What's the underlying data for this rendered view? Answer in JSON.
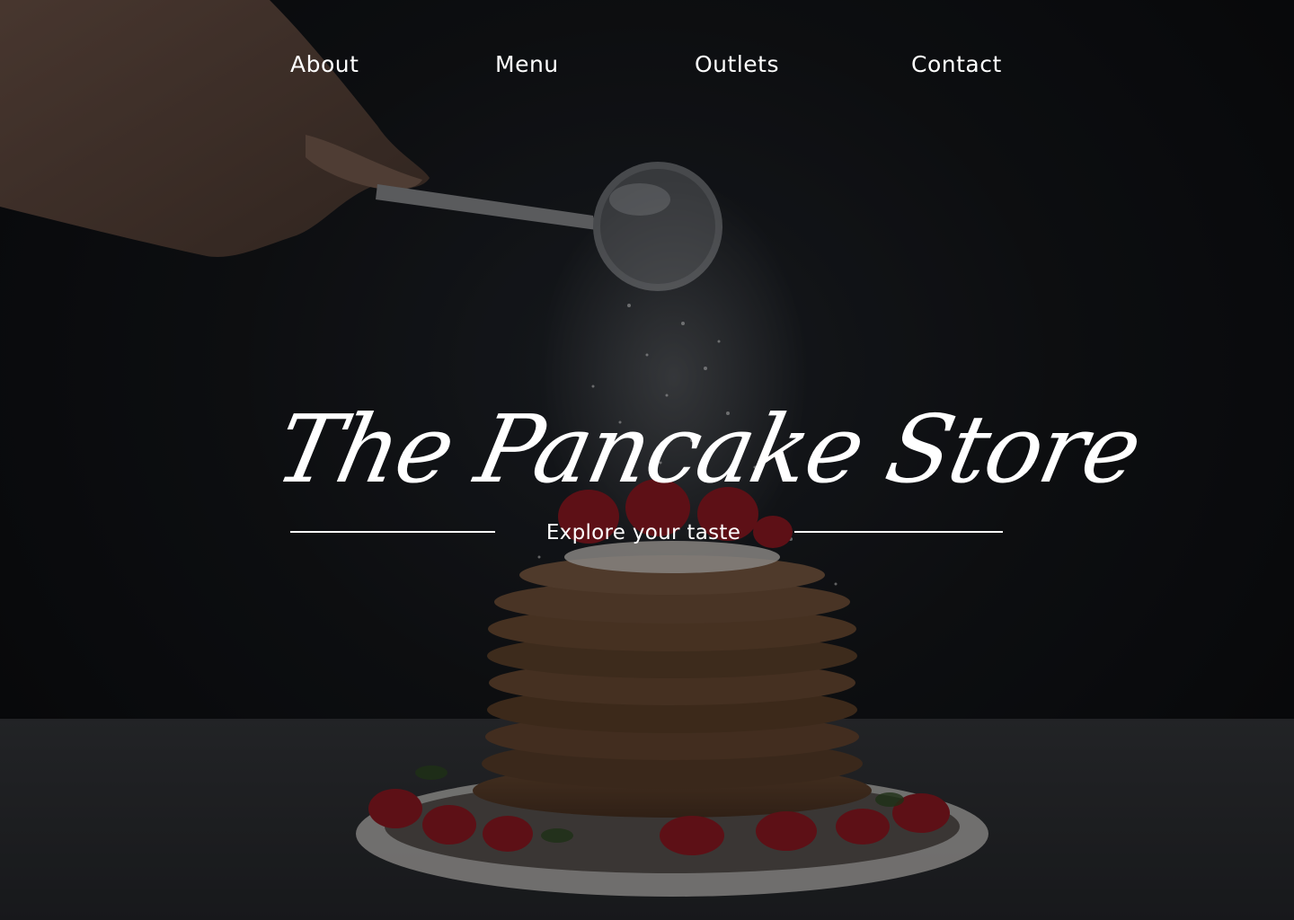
{
  "nav": {
    "items": [
      {
        "label": "About"
      },
      {
        "label": "Menu"
      },
      {
        "label": "Outlets"
      },
      {
        "label": "Contact"
      }
    ]
  },
  "hero": {
    "title": "The Pancake Store",
    "tagline": "Explore your taste"
  },
  "colors": {
    "text": "#ffffff",
    "background": "#0e0f12",
    "table_surface": "#3a3c40",
    "strawberry": "#b3202a",
    "pancake": "#8a6240"
  }
}
